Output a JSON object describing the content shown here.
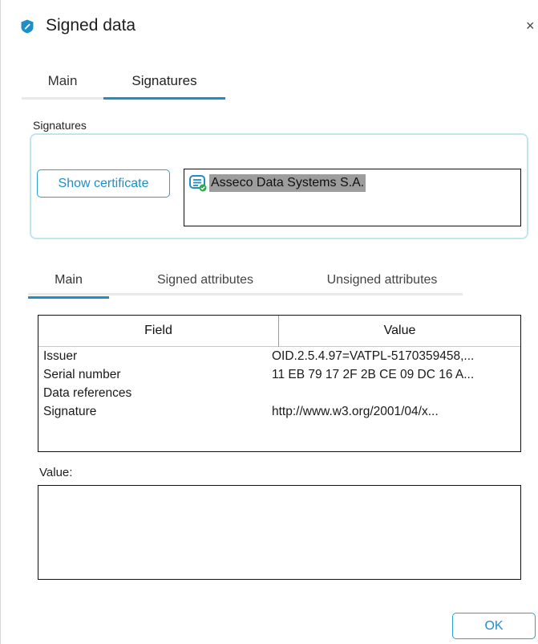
{
  "window": {
    "title": "Signed data",
    "close_glyph": "×",
    "icon": "app-shield-icon",
    "accent": "#1e8fc6"
  },
  "top_tabs": [
    {
      "label": "Main",
      "active": false
    },
    {
      "label": "Signatures",
      "active": true
    }
  ],
  "signatures": {
    "section_label": "Signatures",
    "show_certificate_label": "Show certificate",
    "items": [
      {
        "name": "Asseco Data Systems S.A.",
        "icon": "signed-document-icon",
        "selected": true
      }
    ]
  },
  "detail_tabs": [
    {
      "label": "Main",
      "active": true
    },
    {
      "label": "Signed attributes",
      "active": false
    },
    {
      "label": "Unsigned attributes",
      "active": false
    }
  ],
  "table": {
    "columns": [
      "Field",
      "Value"
    ],
    "rows": [
      {
        "field": "Issuer",
        "value": "OID.2.5.4.97=VATPL-5170359458,..."
      },
      {
        "field": "Serial number",
        "value": "11 EB 79 17 2F 2B CE 09 DC 16 A..."
      },
      {
        "field": "Data references",
        "value": ""
      },
      {
        "field": "Signature",
        "value": "http://www.w3.org/2001/04/x..."
      }
    ]
  },
  "value_panel": {
    "label": "Value:",
    "content": ""
  },
  "footer": {
    "ok_label": "OK"
  }
}
